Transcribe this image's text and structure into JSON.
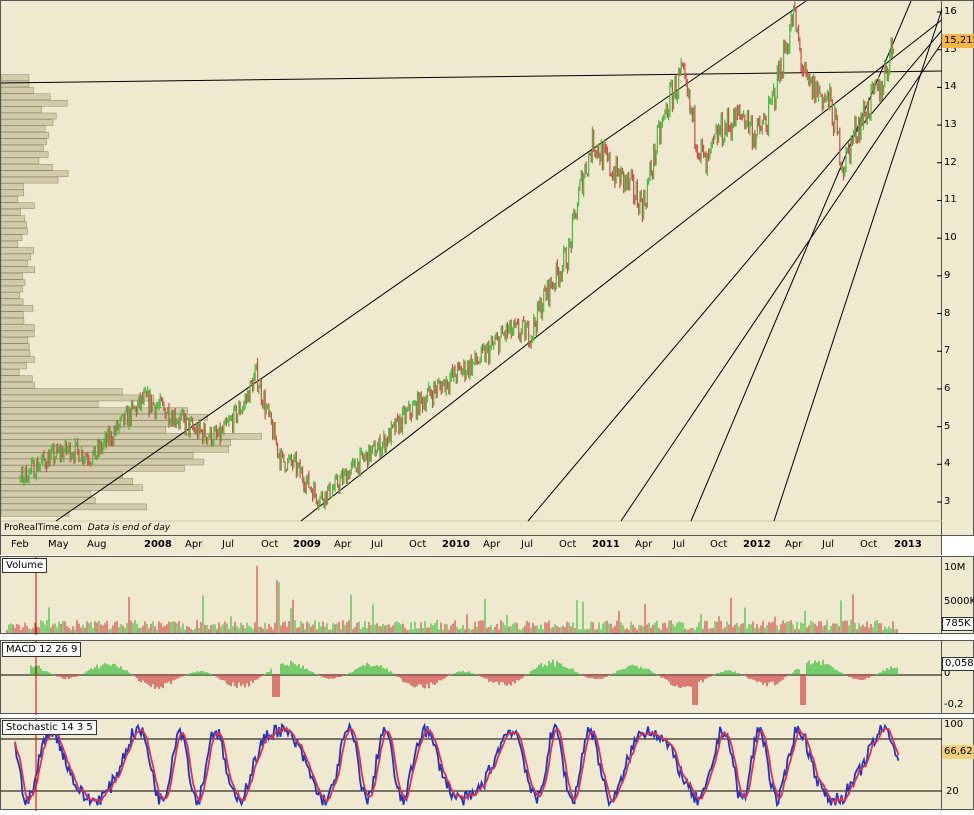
{
  "credit": {
    "brand": "ProRealTime.com",
    "note": "Data is end of day"
  },
  "colors": {
    "background": "#efe9cf",
    "up": "#3fbf3f",
    "down": "#d24a4a",
    "stochK": "#2233cc",
    "stochD": "#dd3344",
    "volprofile": "#d2cba9"
  },
  "chart_data": [
    {
      "type": "line",
      "panel": "price",
      "x_tick_labels": [
        "Feb",
        "May",
        "Aug",
        "2008",
        "Apr",
        "Jul",
        "Oct",
        "2009",
        "Apr",
        "Jul",
        "Oct",
        "2010",
        "Apr",
        "Jul",
        "Oct",
        "2011",
        "Apr",
        "Jul",
        "Oct",
        "2012",
        "Apr",
        "Jul",
        "Oct",
        "2013"
      ],
      "x_range": [
        "2007-02",
        "2013-01"
      ],
      "y_tick_labels": [
        "3",
        "4",
        "5",
        "6",
        "7",
        "8",
        "9",
        "10",
        "11",
        "12",
        "13",
        "14",
        "15",
        "16"
      ],
      "ylim": [
        2.5,
        16.2
      ],
      "last_price": "15,215",
      "series": [
        {
          "points": [
            [
              "2007-02",
              3.6
            ],
            [
              "2007-04",
              4.1
            ],
            [
              "2007-06",
              4.4
            ],
            [
              "2007-08",
              4.2
            ],
            [
              "2007-10",
              5.0
            ],
            [
              "2007-12",
              5.7
            ],
            [
              "2008-02",
              5.4
            ],
            [
              "2008-04",
              4.9
            ],
            [
              "2008-06",
              4.7
            ],
            [
              "2008-08",
              5.6
            ],
            [
              "2008-09",
              6.4
            ],
            [
              "2008-10",
              5.2
            ],
            [
              "2008-11",
              4.1
            ],
            [
              "2008-12",
              4.0
            ],
            [
              "2009-02",
              3.1
            ],
            [
              "2009-03",
              3.3
            ],
            [
              "2009-05",
              4.0
            ],
            [
              "2009-07",
              4.5
            ],
            [
              "2009-09",
              5.3
            ],
            [
              "2009-11",
              5.9
            ],
            [
              "2010-01",
              6.4
            ],
            [
              "2010-03",
              6.8
            ],
            [
              "2010-05",
              7.5
            ],
            [
              "2010-07",
              7.5
            ],
            [
              "2010-08",
              8.4
            ],
            [
              "2010-10",
              9.6
            ],
            [
              "2010-11",
              11.5
            ],
            [
              "2010-12",
              12.6
            ],
            [
              "2011-01",
              12.0
            ],
            [
              "2011-03",
              11.3
            ],
            [
              "2011-04",
              10.9
            ],
            [
              "2011-05",
              12.4
            ],
            [
              "2011-06",
              13.6
            ],
            [
              "2011-07",
              14.3
            ],
            [
              "2011-08",
              13.0
            ],
            [
              "2011-09",
              11.8
            ],
            [
              "2011-10",
              12.8
            ],
            [
              "2011-12",
              13.3
            ],
            [
              "2012-01",
              12.7
            ],
            [
              "2012-02",
              13.2
            ],
            [
              "2012-03",
              14.6
            ],
            [
              "2012-04",
              15.9
            ],
            [
              "2012-05",
              14.0
            ],
            [
              "2012-06",
              13.9
            ],
            [
              "2012-07",
              13.5
            ],
            [
              "2012-08",
              11.9
            ],
            [
              "2012-09",
              12.9
            ],
            [
              "2012-10",
              13.5
            ],
            [
              "2012-11",
              14.0
            ],
            [
              "2012-12",
              15.2
            ]
          ]
        }
      ]
    },
    {
      "type": "bar",
      "panel": "volume",
      "y_tick_labels": [
        "10M",
        "5000K"
      ],
      "last_value": "785K"
    },
    {
      "type": "bar",
      "panel": "macd",
      "params": "12 26 9",
      "y_tick_labels": [
        "0",
        "-0,2"
      ],
      "last_value": "0,058"
    },
    {
      "type": "line",
      "panel": "stochastic",
      "params": "14 3 5",
      "y_tick_labels": [
        "100",
        "20"
      ],
      "last_value": "66,623"
    }
  ],
  "indicators": {
    "volume_title": "Volume",
    "macd_title": "MACD",
    "stochastic_title": "Stochastic"
  }
}
